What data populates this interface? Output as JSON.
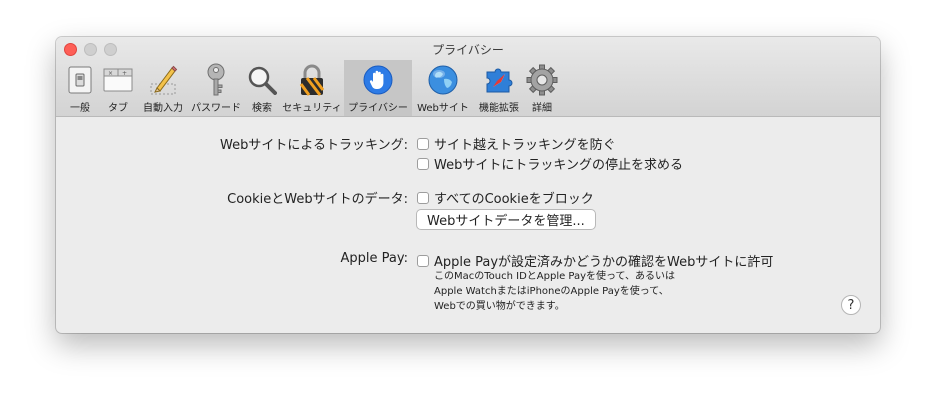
{
  "window": {
    "title": "プライバシー"
  },
  "toolbar": {
    "items": [
      {
        "label": "一般",
        "icon": "switch-icon"
      },
      {
        "label": "タブ",
        "icon": "tabs-icon"
      },
      {
        "label": "自動入力",
        "icon": "pencil-icon"
      },
      {
        "label": "パスワード",
        "icon": "key-icon"
      },
      {
        "label": "検索",
        "icon": "magnifier-icon"
      },
      {
        "label": "セキュリティ",
        "icon": "lock-icon"
      },
      {
        "label": "プライバシー",
        "icon": "hand-icon",
        "selected": true
      },
      {
        "label": "Webサイト",
        "icon": "globe-icon"
      },
      {
        "label": "機能拡張",
        "icon": "puzzle-icon"
      },
      {
        "label": "詳細",
        "icon": "gear-icon"
      }
    ]
  },
  "tracking": {
    "label": "Webサイトによるトラッキング:",
    "option1": "サイト越えトラッキングを防ぐ",
    "option2": "Webサイトにトラッキングの停止を求める"
  },
  "cookies": {
    "label": "CookieとWebサイトのデータ:",
    "option": "すべてのCookieをブロック",
    "manage_button": "Webサイトデータを管理..."
  },
  "applepay": {
    "label": "Apple Pay:",
    "option": "Apple Payが設定済みかどうかの確認をWebサイトに許可",
    "note_line1": "このMacのTouch IDとApple Payを使って、あるいは",
    "note_line2": "Apple WatchまたはiPhoneのApple Payを使って、",
    "note_line3": "Webでの買い物ができます。"
  },
  "help": {
    "label": "?"
  }
}
